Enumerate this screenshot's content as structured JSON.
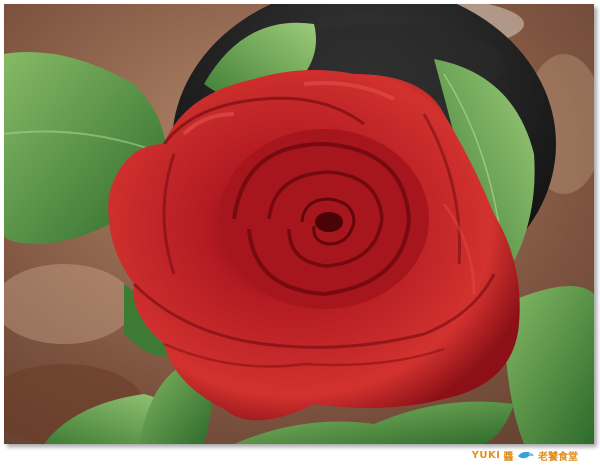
{
  "photo": {
    "subject": "red-rose",
    "colors": {
      "petal_dark": "#7a0a12",
      "petal_mid": "#c01e24",
      "petal_light": "#e0453f",
      "leaf_dark": "#2f6a2a",
      "leaf_light": "#7fb460",
      "vase": "#1e1e1e",
      "table": "#8a5a40"
    }
  },
  "watermark": {
    "brand": "YUKI",
    "glyph_after_brand": "醬",
    "title": "老饕食堂",
    "icon": "dolphin-icon",
    "accent_color": "#e0901c"
  }
}
